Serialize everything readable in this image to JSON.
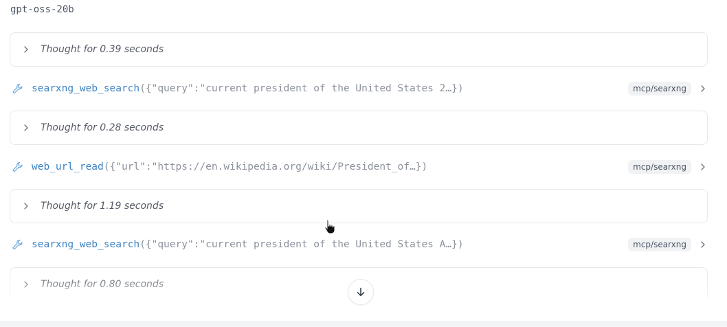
{
  "model_name": "gpt-oss-20b",
  "items": [
    {
      "kind": "thought",
      "label": "Thought for 0.39 seconds"
    },
    {
      "kind": "tool",
      "function": "searxng_web_search",
      "args": "({\"query\":\"current president of the United States 2…})",
      "badge": "mcp/searxng"
    },
    {
      "kind": "thought",
      "label": "Thought for 0.28 seconds"
    },
    {
      "kind": "tool",
      "function": "web_url_read",
      "args": "({\"url\":\"https://en.wikipedia.org/wiki/President_of…})",
      "badge": "mcp/searxng"
    },
    {
      "kind": "thought",
      "label": "Thought for 1.19 seconds"
    },
    {
      "kind": "tool",
      "function": "searxng_web_search",
      "args": "({\"query\":\"current president of the United States A…})",
      "badge": "mcp/searxng"
    },
    {
      "kind": "thought",
      "label": "Thought for 0.80 seconds"
    }
  ],
  "icons": {
    "chevron": "chevron-right-icon",
    "tool": "wrench-icon",
    "scroll": "arrow-down-icon",
    "cursor": "hand-pointer-icon"
  },
  "colors": {
    "function_name": "#3b82c4",
    "args": "#8b919b",
    "border": "#e5e7eb",
    "badge_bg": "#f1f2f4"
  }
}
